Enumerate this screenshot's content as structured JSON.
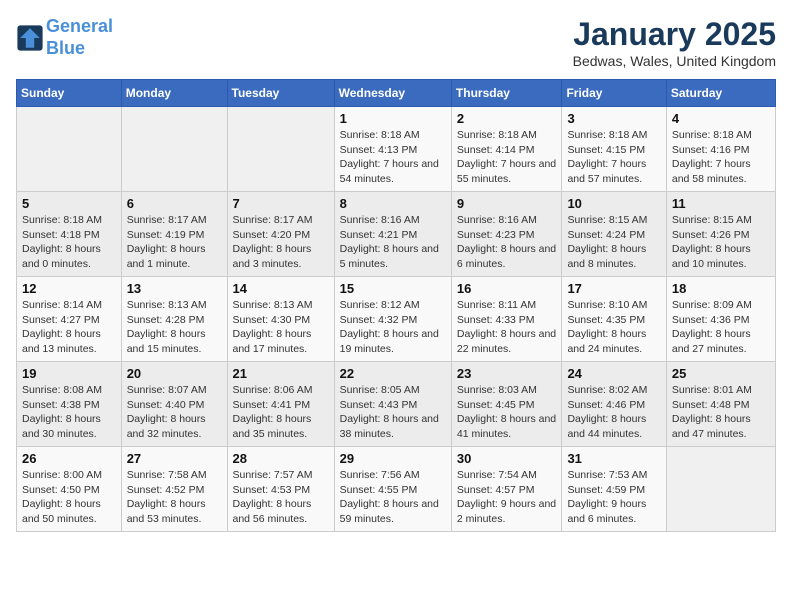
{
  "header": {
    "logo_line1": "General",
    "logo_line2": "Blue",
    "month": "January 2025",
    "location": "Bedwas, Wales, United Kingdom"
  },
  "weekdays": [
    "Sunday",
    "Monday",
    "Tuesday",
    "Wednesday",
    "Thursday",
    "Friday",
    "Saturday"
  ],
  "weeks": [
    [
      {
        "day": "",
        "sunrise": "",
        "sunset": "",
        "daylight": ""
      },
      {
        "day": "",
        "sunrise": "",
        "sunset": "",
        "daylight": ""
      },
      {
        "day": "",
        "sunrise": "",
        "sunset": "",
        "daylight": ""
      },
      {
        "day": "1",
        "sunrise": "Sunrise: 8:18 AM",
        "sunset": "Sunset: 4:13 PM",
        "daylight": "Daylight: 7 hours and 54 minutes."
      },
      {
        "day": "2",
        "sunrise": "Sunrise: 8:18 AM",
        "sunset": "Sunset: 4:14 PM",
        "daylight": "Daylight: 7 hours and 55 minutes."
      },
      {
        "day": "3",
        "sunrise": "Sunrise: 8:18 AM",
        "sunset": "Sunset: 4:15 PM",
        "daylight": "Daylight: 7 hours and 57 minutes."
      },
      {
        "day": "4",
        "sunrise": "Sunrise: 8:18 AM",
        "sunset": "Sunset: 4:16 PM",
        "daylight": "Daylight: 7 hours and 58 minutes."
      }
    ],
    [
      {
        "day": "5",
        "sunrise": "Sunrise: 8:18 AM",
        "sunset": "Sunset: 4:18 PM",
        "daylight": "Daylight: 8 hours and 0 minutes."
      },
      {
        "day": "6",
        "sunrise": "Sunrise: 8:17 AM",
        "sunset": "Sunset: 4:19 PM",
        "daylight": "Daylight: 8 hours and 1 minute."
      },
      {
        "day": "7",
        "sunrise": "Sunrise: 8:17 AM",
        "sunset": "Sunset: 4:20 PM",
        "daylight": "Daylight: 8 hours and 3 minutes."
      },
      {
        "day": "8",
        "sunrise": "Sunrise: 8:16 AM",
        "sunset": "Sunset: 4:21 PM",
        "daylight": "Daylight: 8 hours and 5 minutes."
      },
      {
        "day": "9",
        "sunrise": "Sunrise: 8:16 AM",
        "sunset": "Sunset: 4:23 PM",
        "daylight": "Daylight: 8 hours and 6 minutes."
      },
      {
        "day": "10",
        "sunrise": "Sunrise: 8:15 AM",
        "sunset": "Sunset: 4:24 PM",
        "daylight": "Daylight: 8 hours and 8 minutes."
      },
      {
        "day": "11",
        "sunrise": "Sunrise: 8:15 AM",
        "sunset": "Sunset: 4:26 PM",
        "daylight": "Daylight: 8 hours and 10 minutes."
      }
    ],
    [
      {
        "day": "12",
        "sunrise": "Sunrise: 8:14 AM",
        "sunset": "Sunset: 4:27 PM",
        "daylight": "Daylight: 8 hours and 13 minutes."
      },
      {
        "day": "13",
        "sunrise": "Sunrise: 8:13 AM",
        "sunset": "Sunset: 4:28 PM",
        "daylight": "Daylight: 8 hours and 15 minutes."
      },
      {
        "day": "14",
        "sunrise": "Sunrise: 8:13 AM",
        "sunset": "Sunset: 4:30 PM",
        "daylight": "Daylight: 8 hours and 17 minutes."
      },
      {
        "day": "15",
        "sunrise": "Sunrise: 8:12 AM",
        "sunset": "Sunset: 4:32 PM",
        "daylight": "Daylight: 8 hours and 19 minutes."
      },
      {
        "day": "16",
        "sunrise": "Sunrise: 8:11 AM",
        "sunset": "Sunset: 4:33 PM",
        "daylight": "Daylight: 8 hours and 22 minutes."
      },
      {
        "day": "17",
        "sunrise": "Sunrise: 8:10 AM",
        "sunset": "Sunset: 4:35 PM",
        "daylight": "Daylight: 8 hours and 24 minutes."
      },
      {
        "day": "18",
        "sunrise": "Sunrise: 8:09 AM",
        "sunset": "Sunset: 4:36 PM",
        "daylight": "Daylight: 8 hours and 27 minutes."
      }
    ],
    [
      {
        "day": "19",
        "sunrise": "Sunrise: 8:08 AM",
        "sunset": "Sunset: 4:38 PM",
        "daylight": "Daylight: 8 hours and 30 minutes."
      },
      {
        "day": "20",
        "sunrise": "Sunrise: 8:07 AM",
        "sunset": "Sunset: 4:40 PM",
        "daylight": "Daylight: 8 hours and 32 minutes."
      },
      {
        "day": "21",
        "sunrise": "Sunrise: 8:06 AM",
        "sunset": "Sunset: 4:41 PM",
        "daylight": "Daylight: 8 hours and 35 minutes."
      },
      {
        "day": "22",
        "sunrise": "Sunrise: 8:05 AM",
        "sunset": "Sunset: 4:43 PM",
        "daylight": "Daylight: 8 hours and 38 minutes."
      },
      {
        "day": "23",
        "sunrise": "Sunrise: 8:03 AM",
        "sunset": "Sunset: 4:45 PM",
        "daylight": "Daylight: 8 hours and 41 minutes."
      },
      {
        "day": "24",
        "sunrise": "Sunrise: 8:02 AM",
        "sunset": "Sunset: 4:46 PM",
        "daylight": "Daylight: 8 hours and 44 minutes."
      },
      {
        "day": "25",
        "sunrise": "Sunrise: 8:01 AM",
        "sunset": "Sunset: 4:48 PM",
        "daylight": "Daylight: 8 hours and 47 minutes."
      }
    ],
    [
      {
        "day": "26",
        "sunrise": "Sunrise: 8:00 AM",
        "sunset": "Sunset: 4:50 PM",
        "daylight": "Daylight: 8 hours and 50 minutes."
      },
      {
        "day": "27",
        "sunrise": "Sunrise: 7:58 AM",
        "sunset": "Sunset: 4:52 PM",
        "daylight": "Daylight: 8 hours and 53 minutes."
      },
      {
        "day": "28",
        "sunrise": "Sunrise: 7:57 AM",
        "sunset": "Sunset: 4:53 PM",
        "daylight": "Daylight: 8 hours and 56 minutes."
      },
      {
        "day": "29",
        "sunrise": "Sunrise: 7:56 AM",
        "sunset": "Sunset: 4:55 PM",
        "daylight": "Daylight: 8 hours and 59 minutes."
      },
      {
        "day": "30",
        "sunrise": "Sunrise: 7:54 AM",
        "sunset": "Sunset: 4:57 PM",
        "daylight": "Daylight: 9 hours and 2 minutes."
      },
      {
        "day": "31",
        "sunrise": "Sunrise: 7:53 AM",
        "sunset": "Sunset: 4:59 PM",
        "daylight": "Daylight: 9 hours and 6 minutes."
      },
      {
        "day": "",
        "sunrise": "",
        "sunset": "",
        "daylight": ""
      }
    ]
  ]
}
